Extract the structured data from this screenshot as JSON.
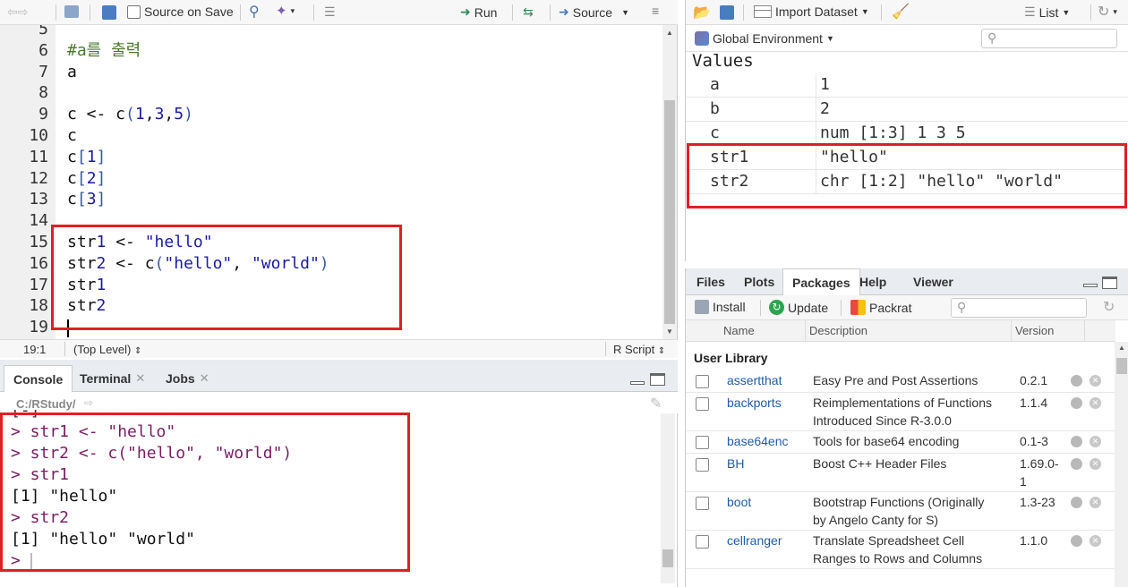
{
  "editor": {
    "toolbar": {
      "source_on_save": "Source on Save",
      "run": "Run",
      "source": "Source"
    },
    "lines": [
      {
        "n": "5",
        "code": ""
      },
      {
        "n": "6",
        "code": "#a를 출력",
        "type": "comment"
      },
      {
        "n": "7",
        "code": "a"
      },
      {
        "n": "8",
        "code": ""
      },
      {
        "n": "9",
        "code": "c <- c(1,3,5)"
      },
      {
        "n": "10",
        "code": "c"
      },
      {
        "n": "11",
        "code": "c[1]"
      },
      {
        "n": "12",
        "code": "c[2]"
      },
      {
        "n": "13",
        "code": "c[3]"
      },
      {
        "n": "14",
        "code": ""
      },
      {
        "n": "15",
        "code": "str1 <- \"hello\""
      },
      {
        "n": "16",
        "code": "str2 <- c(\"hello\", \"world\")"
      },
      {
        "n": "17",
        "code": "str1"
      },
      {
        "n": "18",
        "code": "str2"
      },
      {
        "n": "19",
        "code": ""
      }
    ],
    "status": {
      "position": "19:1",
      "scope": "(Top Level)",
      "filetype": "R Script"
    }
  },
  "console": {
    "tabs": [
      "Console",
      "Terminal",
      "Jobs"
    ],
    "path": "C:/RStudy/",
    "lines": [
      {
        "text": "> str1 <- \"hello\"",
        "type": "input"
      },
      {
        "text": "> str2 <- c(\"hello\", \"world\")",
        "type": "input"
      },
      {
        "text": "> str1",
        "type": "input"
      },
      {
        "text": "[1] \"hello\"",
        "type": "output"
      },
      {
        "text": "> str2",
        "type": "input"
      },
      {
        "text": "[1] \"hello\" \"world\"",
        "type": "output"
      },
      {
        "text": ">",
        "type": "prompt"
      }
    ]
  },
  "environment": {
    "toolbar": {
      "import_dataset": "Import Dataset",
      "view_mode": "List"
    },
    "scope": "Global Environment",
    "section": "Values",
    "rows": [
      {
        "name": "a",
        "value": "1"
      },
      {
        "name": "b",
        "value": "2"
      },
      {
        "name": "c",
        "value": "num [1:3] 1 3 5"
      },
      {
        "name": "str1",
        "value": "\"hello\""
      },
      {
        "name": "str2",
        "value": "chr [1:2] \"hello\" \"world\""
      }
    ]
  },
  "files_pane": {
    "tabs": [
      "Files",
      "Plots",
      "Packages",
      "Help",
      "Viewer"
    ],
    "active_tab": "Packages",
    "toolbar": {
      "install": "Install",
      "update": "Update",
      "packrat": "Packrat"
    },
    "columns": {
      "name": "Name",
      "description": "Description",
      "version": "Version"
    },
    "section": "User Library",
    "packages": [
      {
        "name": "assertthat",
        "desc": [
          "Easy Pre and Post Assertions"
        ],
        "version": [
          "0.2.1"
        ]
      },
      {
        "name": "backports",
        "desc": [
          "Reimplementations of Functions",
          "Introduced Since R-3.0.0"
        ],
        "version": [
          "1.1.4"
        ]
      },
      {
        "name": "base64enc",
        "desc": [
          "Tools for base64 encoding"
        ],
        "version": [
          "0.1-3"
        ]
      },
      {
        "name": "BH",
        "desc": [
          "Boost C++ Header Files"
        ],
        "version": [
          "1.69.0-",
          "1"
        ]
      },
      {
        "name": "boot",
        "desc": [
          "Bootstrap Functions (Originally",
          "by Angelo Canty for S)"
        ],
        "version": [
          "1.3-23"
        ]
      },
      {
        "name": "cellranger",
        "desc": [
          "Translate Spreadsheet Cell",
          "Ranges to Rows and Columns"
        ],
        "version": [
          "1.1.0"
        ]
      }
    ]
  },
  "colors": {
    "comment": "#4a7a2c",
    "string": "#1a1aa6",
    "number": "#1a1aa6",
    "console_input": "#7b1e63",
    "highlight_red": "#e02020",
    "link": "#1f5da6"
  }
}
